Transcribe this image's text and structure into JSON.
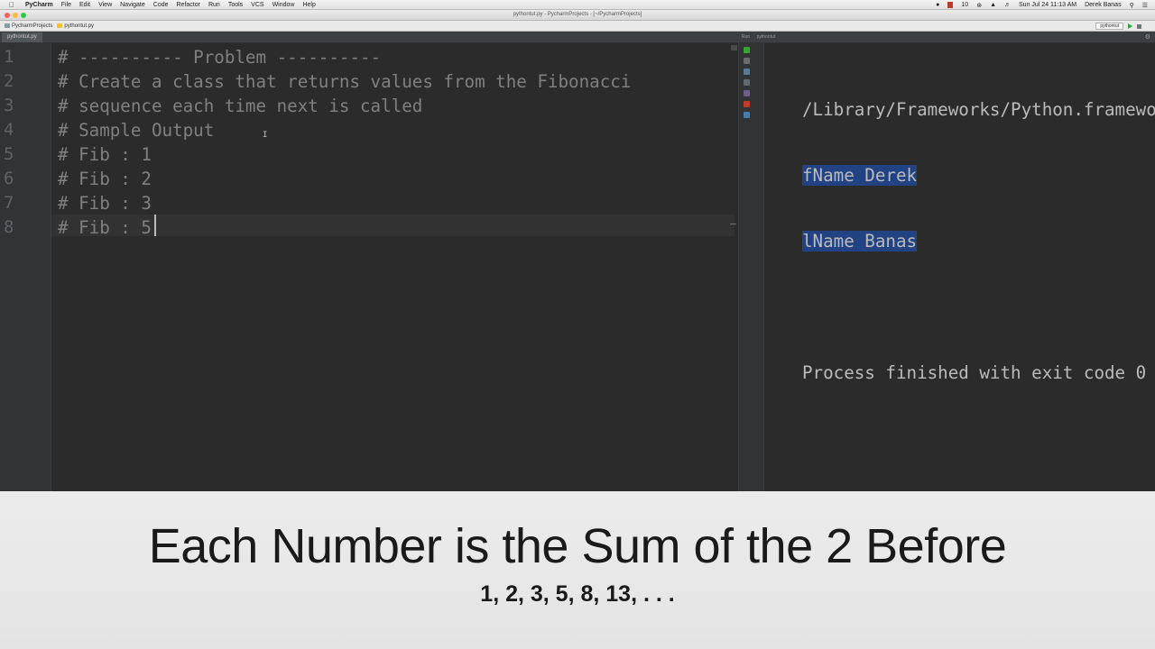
{
  "menubar": {
    "app_name": "PyCharm",
    "menus": [
      "File",
      "Edit",
      "View",
      "Navigate",
      "Code",
      "Refactor",
      "Run",
      "Tools",
      "VCS",
      "Window",
      "Help"
    ],
    "tray_number": "10",
    "datetime": "Sun Jul 24  11:13 AM",
    "user": "Derek Banas"
  },
  "window": {
    "title": "pythontut.py - PycharmProjects - [~/PycharmProjects]"
  },
  "navbar": {
    "crumbs": [
      "PycharmProjects",
      "pythontut.py"
    ],
    "run_config": "pythontut"
  },
  "editor": {
    "tab_label": "pythontut.py",
    "line_numbers": [
      "1",
      "2",
      "3",
      "4",
      "5",
      "6",
      "7",
      "8"
    ],
    "lines": [
      "# ---------- Problem ----------",
      "# Create a class that returns values from the Fibonacci",
      "# sequence each time next is called",
      "# Sample Output",
      "# Fib : 1",
      "# Fib : 2",
      "# Fib : 3",
      "# Fib : 5"
    ]
  },
  "run_panel": {
    "header_label": "Run",
    "config_name": "pythontut",
    "output": [
      "/Library/Frameworks/Python.framewor",
      "fName Derek",
      "lName Banas",
      "",
      "Process finished with exit code 0"
    ]
  },
  "banner": {
    "title": "Each Number is the Sum of the 2 Before",
    "subtitle": "1, 2, 3, 5, 8, 13, . . ."
  }
}
